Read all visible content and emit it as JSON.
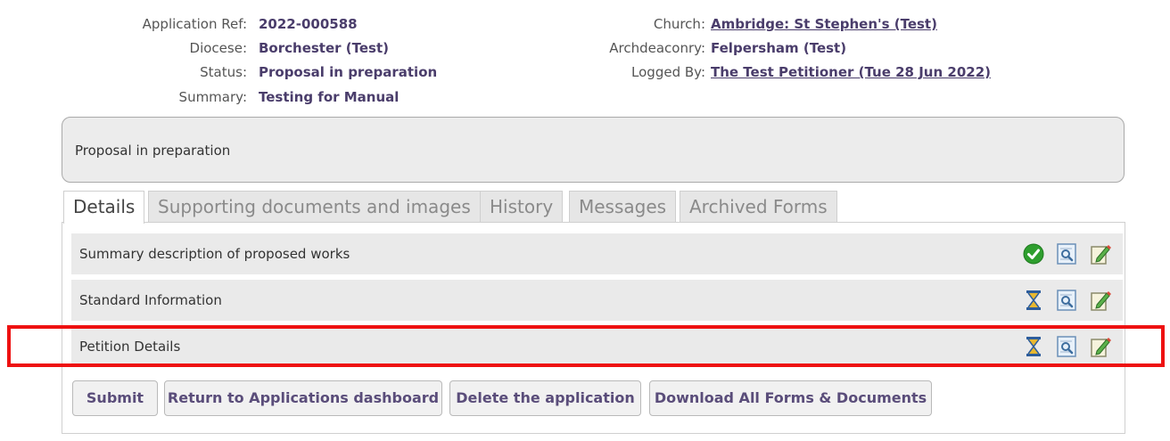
{
  "application": {
    "ref_label": "Application Ref:",
    "ref_value": "2022-000588",
    "diocese_label": "Diocese:",
    "diocese_value": "Borchester (Test)",
    "status_label": "Status:",
    "status_value": "Proposal in preparation",
    "summary_label": "Summary:",
    "summary_value": "Testing for Manual",
    "church_label": "Church:",
    "church_value": "Ambridge: St Stephen's (Test)",
    "archdeaconry_label": "Archdeaconry:",
    "archdeaconry_value": "Felpersham (Test)",
    "logged_by_label": "Logged By:",
    "logged_by_value": "The Test Petitioner (Tue 28 Jun 2022)"
  },
  "status_box": {
    "text": "Proposal in preparation"
  },
  "tabs": [
    {
      "label": "Details",
      "active": true
    },
    {
      "label": "Supporting documents and images",
      "active": false
    },
    {
      "label": "History",
      "active": false
    },
    {
      "label": "Messages",
      "active": false
    },
    {
      "label": "Archived Forms",
      "active": false
    }
  ],
  "forms": [
    {
      "title": "Summary description of proposed works",
      "state_icon": "check-icon",
      "highlighted": false
    },
    {
      "title": "Standard Information",
      "state_icon": "hourglass-icon",
      "highlighted": false
    },
    {
      "title": "Petition Details",
      "state_icon": "hourglass-icon",
      "highlighted": true
    }
  ],
  "buttons": {
    "submit": "Submit",
    "return": "Return to Applications dashboard",
    "delete": "Delete the application",
    "download": "Download All Forms & Documents"
  },
  "colors": {
    "highlight": "#ee1111",
    "link": "#4a3d6b",
    "check_green": "#2e9e2e"
  }
}
